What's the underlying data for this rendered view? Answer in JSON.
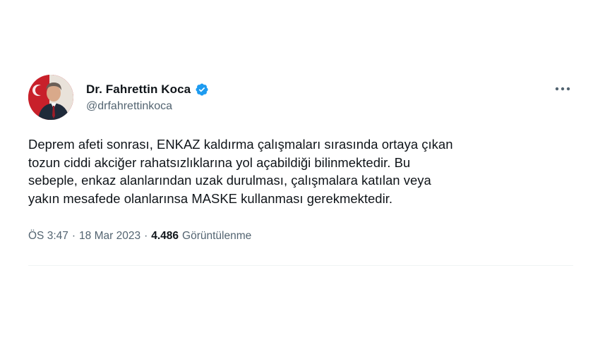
{
  "author": {
    "display_name": "Dr. Fahrettin Koca",
    "handle": "@drfahrettinkoca",
    "avatar_icon": "profile-photo",
    "verified_icon": "verified-badge-icon",
    "verified_color": "#1d9bf0"
  },
  "actions": {
    "more_icon": "more-horizontal-icon",
    "more_label": "•••"
  },
  "tweet": {
    "text": "Deprem afeti sonrası, ENKAZ kaldırma çalışmaları sırasında ortaya çıkan\ntozun ciddi akciğer rahatsızlıklarına yol açabildiği bilinmektedir. Bu\nsebeple, enkaz alanlarından uzak durulması, çalışmalara katılan veya\nyakın mesafede olanlarınsa MASKE kullanması gerekmektedir."
  },
  "meta": {
    "time": "ÖS 3:47",
    "separator": "·",
    "date": "18 Mar 2023",
    "views_count": "4.486",
    "views_label": "Görüntülenme"
  },
  "colors": {
    "text_primary": "#0f1419",
    "text_secondary": "#536471",
    "avatar_background": "#c8202a",
    "divider": "#eff3f4"
  }
}
